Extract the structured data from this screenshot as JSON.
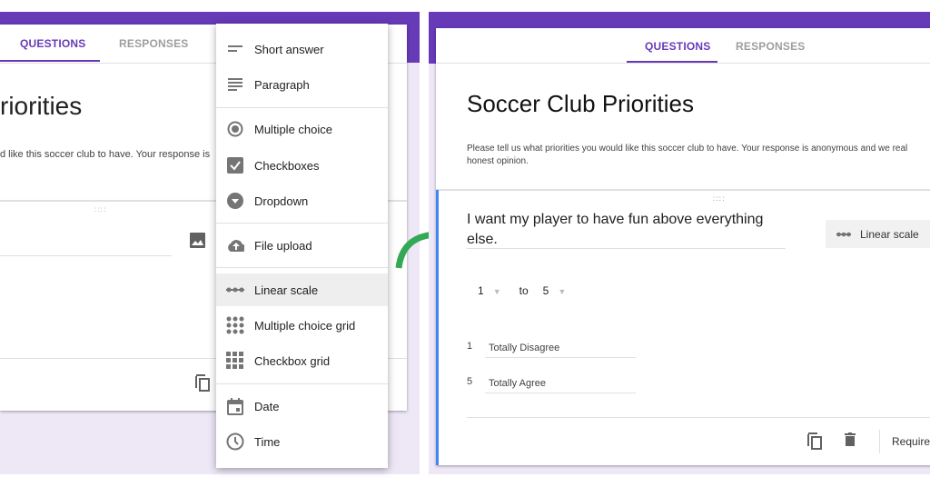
{
  "left": {
    "tabs": [
      {
        "label": "QUESTIONS",
        "active": true
      },
      {
        "label": "RESPONSES",
        "active": false
      }
    ],
    "title_fragment": "riorities",
    "description_fragment": "d like this soccer club to have. Your response is",
    "menu": [
      {
        "label": "Short answer",
        "icon": "short-answer-icon"
      },
      {
        "label": "Paragraph",
        "icon": "paragraph-icon"
      },
      {
        "label": "Multiple choice",
        "icon": "radio-icon"
      },
      {
        "label": "Checkboxes",
        "icon": "checkbox-icon"
      },
      {
        "label": "Dropdown",
        "icon": "dropdown-icon"
      },
      {
        "label": "File upload",
        "icon": "cloud-upload-icon"
      },
      {
        "label": "Linear scale",
        "icon": "linear-scale-icon",
        "selected": true
      },
      {
        "label": "Multiple choice grid",
        "icon": "dot-grid-icon"
      },
      {
        "label": "Checkbox grid",
        "icon": "square-grid-icon"
      },
      {
        "label": "Date",
        "icon": "calendar-icon"
      },
      {
        "label": "Time",
        "icon": "clock-icon"
      }
    ]
  },
  "right": {
    "tabs": [
      {
        "label": "QUESTIONS",
        "active": true
      },
      {
        "label": "RESPONSES",
        "active": false
      }
    ],
    "title": "Soccer Club Priorities",
    "description_line1": "Please tell us what priorities you would like this soccer club to have. Your response is anonymous and we real",
    "description_line2": "honest opinion.",
    "question": {
      "text_line1": "I want my player to have fun above everything",
      "text_line2": "else.",
      "type": "Linear scale",
      "scale_from": "1",
      "scale_to_word": "to",
      "scale_to": "5",
      "labels": [
        {
          "num": "1",
          "text": "Totally Disagree"
        },
        {
          "num": "5",
          "text": "Totally Agree"
        }
      ],
      "required_label": "Required"
    }
  },
  "colors": {
    "brand": "#673ab7",
    "background": "#ede7f6",
    "active_border": "#4285f4",
    "arrow": "#34a853"
  }
}
